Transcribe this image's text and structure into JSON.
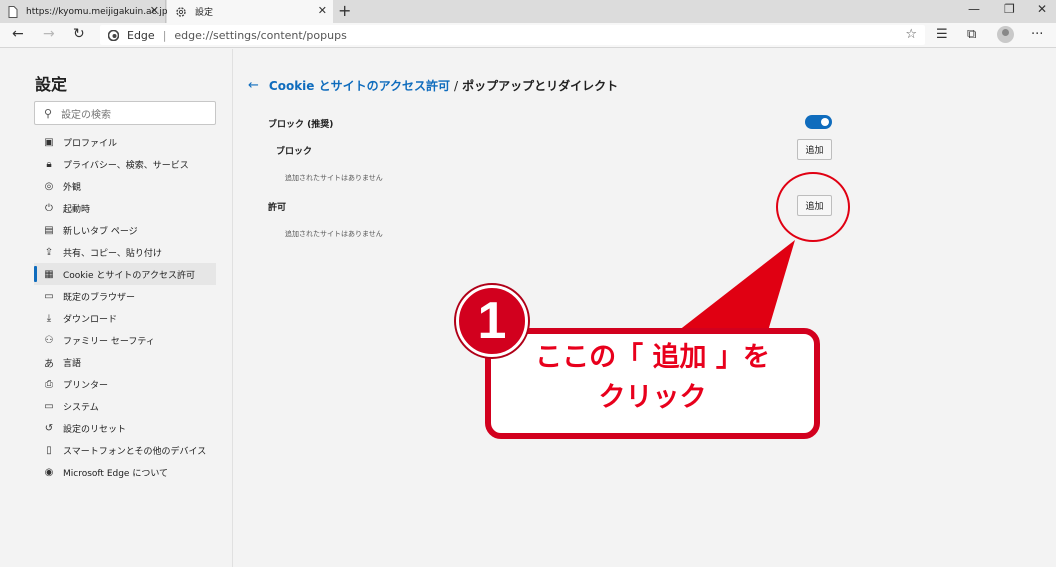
{
  "tabs": [
    {
      "title": "https://kyomu.meijigakuin.ac.jp"
    },
    {
      "title": "設定"
    }
  ],
  "address_bar": {
    "browser_label": "Edge",
    "url": "edge://settings/content/popups"
  },
  "sidebar": {
    "title": "設定",
    "search_placeholder": "設定の検索",
    "items": [
      {
        "label": "プロファイル",
        "icon": "profile-icon"
      },
      {
        "label": "プライバシー、検索、サービス",
        "icon": "lock-icon"
      },
      {
        "label": "外観",
        "icon": "palette-icon"
      },
      {
        "label": "起動時",
        "icon": "power-icon"
      },
      {
        "label": "新しいタブ ページ",
        "icon": "newtab-icon"
      },
      {
        "label": "共有、コピー、貼り付け",
        "icon": "share-icon"
      },
      {
        "label": "Cookie とサイトのアクセス許可",
        "icon": "site-permissions-icon",
        "active": true
      },
      {
        "label": "既定のブラウザー",
        "icon": "browser-icon"
      },
      {
        "label": "ダウンロード",
        "icon": "download-icon"
      },
      {
        "label": "ファミリー セーフティ",
        "icon": "family-icon"
      },
      {
        "label": "言語",
        "icon": "language-icon"
      },
      {
        "label": "プリンター",
        "icon": "printer-icon"
      },
      {
        "label": "システム",
        "icon": "system-icon"
      },
      {
        "label": "設定のリセット",
        "icon": "reset-icon"
      },
      {
        "label": "スマートフォンとその他のデバイス",
        "icon": "phone-icon"
      },
      {
        "label": "Microsoft Edge について",
        "icon": "edge-logo-icon"
      }
    ]
  },
  "main": {
    "breadcrumb_parent": "Cookie とサイトのアクセス許可",
    "breadcrumb_separator": "/",
    "breadcrumb_current": "ポップアップとリダイレクト",
    "block_recommended_label": "ブロック (推奨)",
    "block_recommended_on": true,
    "block_section": {
      "label": "ブロック",
      "add_button": "追加",
      "empty_text": "追加されたサイトはありません"
    },
    "allow_section": {
      "label": "許可",
      "add_button": "追加",
      "empty_text": "追加されたサイトはありません"
    }
  },
  "annotation": {
    "badge_number": "1",
    "line1": "ここの「 追加 」を",
    "line2": "クリック",
    "color": "#e00012"
  }
}
